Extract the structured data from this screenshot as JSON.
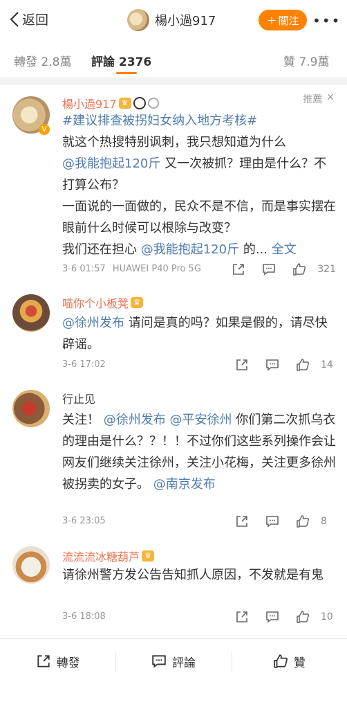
{
  "nav": {
    "back_label": "返回",
    "author_name": "楊小過917",
    "follow_label": "關注",
    "more_label": "•••"
  },
  "tabs": {
    "repost": "轉發 2.8萬",
    "comments": "評論 2376",
    "likes": "贊 7.9萬"
  },
  "comments": [
    {
      "name": "楊小過917",
      "recommend": "推薦",
      "text_parts": {
        "hashtag": "#建议排查被拐妇女纳入地方考核#",
        "p1": "就这个热搜特别讽刺，我只想知道为什么",
        "mention1": "@我能抱起120斤",
        "p2": "又一次被抓？理由是什么？不打算公布？",
        "p3": "一面说的一面做的，民众不是不信，而是事实摆在眼前什么时候可以根除与改变？",
        "p4": "我们还在担心",
        "mention2": "@我能抱起120斤",
        "p5": "的...",
        "more": "全文"
      },
      "time": "3-6 01:57",
      "device": "HUAWEI P40 Pro 5G",
      "likes": "321"
    },
    {
      "name": "喵你个小板凳",
      "text_parts": {
        "mention": "@徐州发布",
        "p1": "请问是真的吗？如果是假的，请尽快辟谣。"
      },
      "time": "3-6 17:02",
      "likes": "14"
    },
    {
      "name": "行止见",
      "text_parts": {
        "p0": "关注！",
        "mention1": "@徐州发布",
        "mention2": "@平安徐州",
        "p1": "你们第二次抓乌衣的理由是什么？？！！不过你们这些系列操作会让网友们继续关注徐州，关注小花梅，关注更多徐州被拐卖的女子。",
        "mention3": "@南京发布"
      },
      "time": "3-6 23:05",
      "likes": "8"
    },
    {
      "name": "流流流冰糖葫芦",
      "text_parts": {
        "p1": "请徐州警方发公告告知抓人原因，不发就是有鬼"
      },
      "time": "3-6 18:08",
      "likes": "10"
    }
  ],
  "bottom": {
    "repost": "轉發",
    "comment": "評論",
    "like": "贊"
  },
  "colors": {
    "accent": "#ff8200",
    "name_orange": "#eb7350",
    "link_blue": "#507daf"
  }
}
